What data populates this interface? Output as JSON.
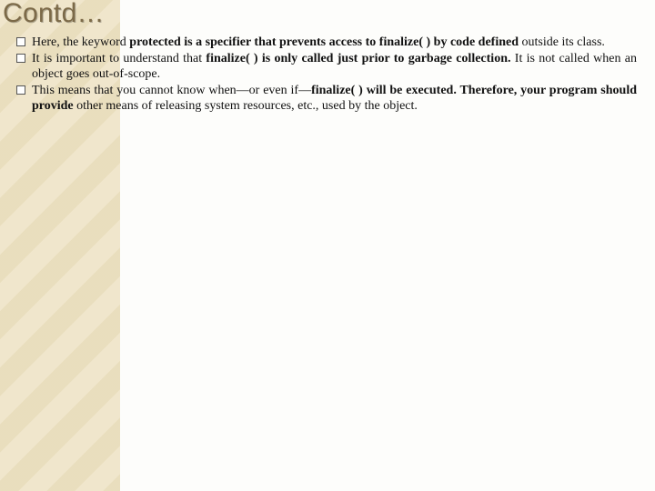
{
  "title": "Contd…",
  "bullets": [
    {
      "pre": "Here, the keyword ",
      "bold1": "protected is a specifier that prevents access to finalize( ) by code defined ",
      "post1": "outside its class."
    },
    {
      "pre": "It is important to understand that ",
      "bold1": "finalize( ) is only called just prior to garbage collection.",
      "post1": " It is not called when an object goes out-of-scope."
    },
    {
      "pre": "This means that you cannot know when—or even if—",
      "bold1": "finalize( ) will be executed. Therefore, your program should provide ",
      "post1": "other means of releasing system resources, etc., used by the object."
    }
  ]
}
